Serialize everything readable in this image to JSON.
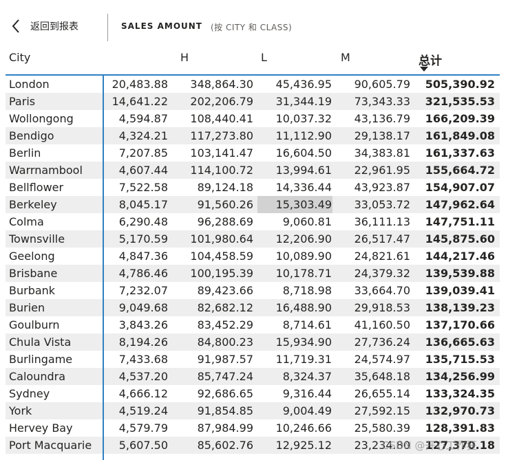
{
  "header": {
    "back_label": "返回到报表",
    "title": "SALES AMOUNT",
    "subtitle": "(按 CITY 和 CLASS)"
  },
  "table": {
    "columns": [
      "City",
      "H",
      "L",
      "M",
      "总计"
    ],
    "rows": [
      {
        "city": "London",
        "h": "20,483.88",
        "l": "348,864.30",
        "m": "45,436.95",
        "m2": "90,605.79",
        "total": "505,390.92"
      },
      {
        "city": "Paris",
        "h": "14,641.22",
        "l": "202,206.79",
        "m": "31,344.19",
        "m2": "73,343.33",
        "total": "321,535.53"
      },
      {
        "city": "Wollongong",
        "h": "4,594.87",
        "l": "108,440.41",
        "m": "10,037.32",
        "m2": "43,136.79",
        "total": "166,209.39"
      },
      {
        "city": "Bendigo",
        "h": "4,324.21",
        "l": "117,273.80",
        "m": "11,112.90",
        "m2": "29,138.17",
        "total": "161,849.08"
      },
      {
        "city": "Berlin",
        "h": "7,207.85",
        "l": "103,141.47",
        "m": "16,604.50",
        "m2": "34,383.81",
        "total": "161,337.63"
      },
      {
        "city": "Warrnambool",
        "h": "4,607.44",
        "l": "114,100.72",
        "m": "13,994.61",
        "m2": "22,961.95",
        "total": "155,664.72"
      },
      {
        "city": "Bellflower",
        "h": "7,522.58",
        "l": "89,124.18",
        "m": "14,336.44",
        "m2": "43,923.87",
        "total": "154,907.07"
      },
      {
        "city": "Berkeley",
        "h": "8,045.17",
        "l": "91,560.26",
        "m": "15,303.49",
        "m2": "33,053.72",
        "total": "147,962.64"
      },
      {
        "city": "Colma",
        "h": "6,290.48",
        "l": "96,288.69",
        "m": "9,060.81",
        "m2": "36,111.13",
        "total": "147,751.11"
      },
      {
        "city": "Townsville",
        "h": "5,170.59",
        "l": "101,980.64",
        "m": "12,206.90",
        "m2": "26,517.47",
        "total": "145,875.60"
      },
      {
        "city": "Geelong",
        "h": "4,847.36",
        "l": "104,458.59",
        "m": "10,089.90",
        "m2": "24,821.61",
        "total": "144,217.46"
      },
      {
        "city": "Brisbane",
        "h": "4,786.46",
        "l": "100,195.39",
        "m": "10,178.71",
        "m2": "24,379.32",
        "total": "139,539.88"
      },
      {
        "city": "Burbank",
        "h": "7,232.07",
        "l": "89,423.66",
        "m": "8,718.98",
        "m2": "33,664.70",
        "total": "139,039.41"
      },
      {
        "city": "Burien",
        "h": "9,049.68",
        "l": "82,682.12",
        "m": "16,488.90",
        "m2": "29,918.53",
        "total": "138,139.23"
      },
      {
        "city": "Goulburn",
        "h": "3,843.26",
        "l": "83,452.29",
        "m": "8,714.61",
        "m2": "41,160.50",
        "total": "137,170.66"
      },
      {
        "city": "Chula Vista",
        "h": "8,194.26",
        "l": "84,800.23",
        "m": "15,934.90",
        "m2": "27,736.24",
        "total": "136,665.63"
      },
      {
        "city": "Burlingame",
        "h": "7,433.68",
        "l": "91,987.57",
        "m": "11,719.31",
        "m2": "24,574.97",
        "total": "135,715.53"
      },
      {
        "city": "Caloundra",
        "h": "4,537.20",
        "l": "85,747.24",
        "m": "8,324.37",
        "m2": "35,648.18",
        "total": "134,256.99"
      },
      {
        "city": "Sydney",
        "h": "4,666.12",
        "l": "92,686.65",
        "m": "9,316.44",
        "m2": "26,655.14",
        "total": "133,324.35"
      },
      {
        "city": "York",
        "h": "4,519.24",
        "l": "91,854.85",
        "m": "9,004.49",
        "m2": "27,592.15",
        "total": "132,970.73"
      },
      {
        "city": "Hervey Bay",
        "h": "4,579.79",
        "l": "87,984.99",
        "m": "10,246.66",
        "m2": "25,580.39",
        "total": "128,391.83"
      },
      {
        "city": "Port Macquarie",
        "h": "5,607.50",
        "l": "85,602.76",
        "m": "12,925.12",
        "m2": "23,234.80",
        "total": "127,370.18"
      }
    ],
    "highlighted_row": 7
  },
  "watermark": "CSDN @开心工作狂",
  "colors": {
    "accent": "#2f7fc1",
    "alt_row": "#eeeeee",
    "highlight": "#d2d2d2"
  }
}
